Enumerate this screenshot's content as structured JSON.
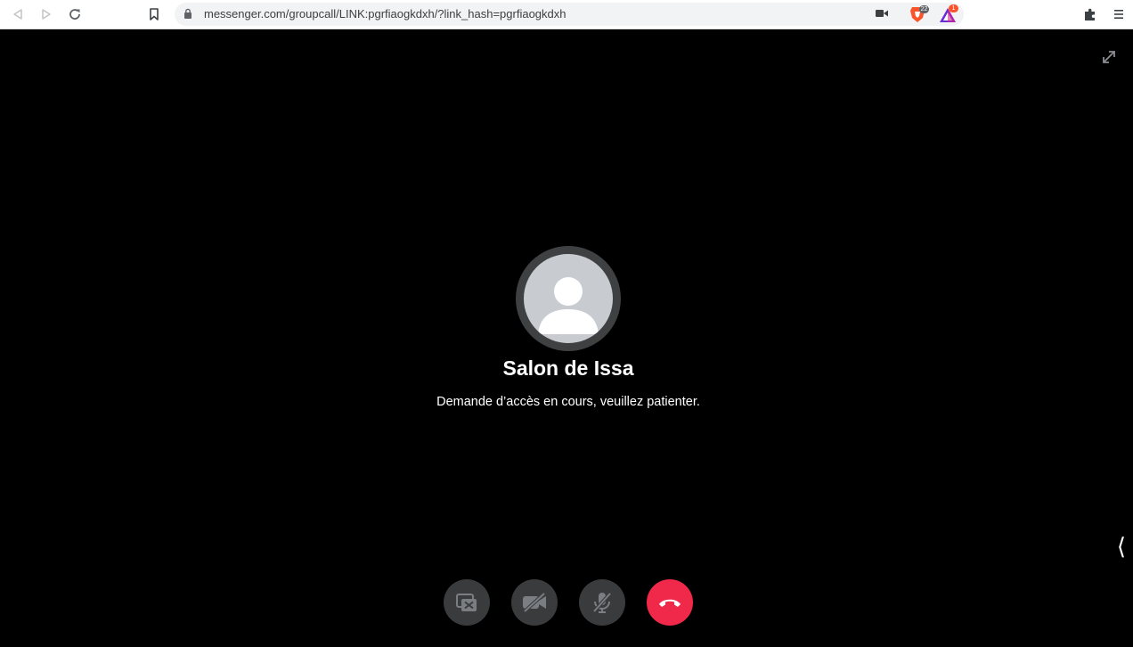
{
  "browser": {
    "url": "messenger.com/groupcall/LINK:pgrfiaogkdxh/?link_hash=pgrfiaogkdxh",
    "extensions": {
      "brave_shields_count": "22",
      "rewards_count": "1"
    }
  },
  "call": {
    "room_title": "Salon de Issa",
    "status": "Demande d’accès en cours, veuillez patienter.",
    "side_toggle": "⟨"
  },
  "colors": {
    "background": "#000000",
    "control_button": "#3a3b3c",
    "hangup": "#f02849",
    "avatar_ring": "#3e4042"
  },
  "icons": [
    "back-icon",
    "forward-icon",
    "reload-icon",
    "bookmark-icon",
    "lock-icon",
    "camera-icon",
    "brave-shields-icon",
    "brave-rewards-icon",
    "extensions-icon",
    "menu-icon",
    "expand-icon",
    "avatar-placeholder-icon",
    "screen-share-off-icon",
    "video-off-icon",
    "mic-off-icon",
    "hang-up-icon"
  ]
}
